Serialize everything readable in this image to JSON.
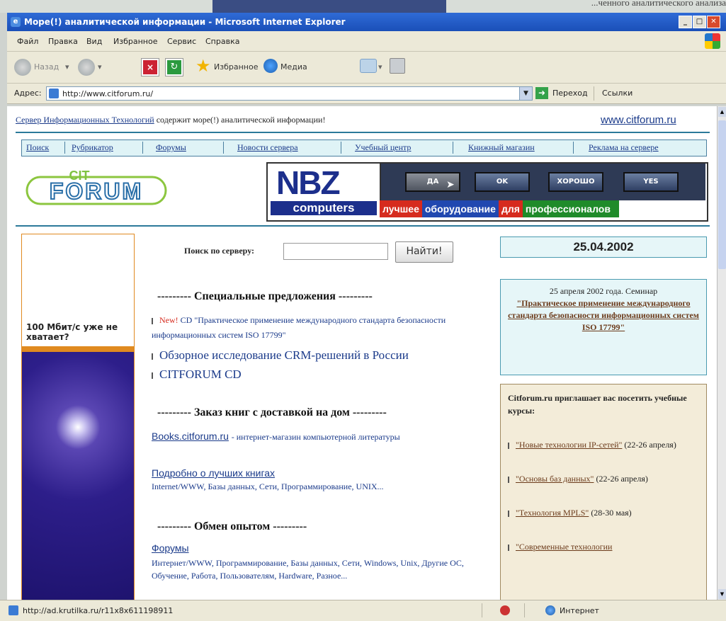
{
  "window": {
    "top_strip_text": "...ченного аналитического анализа",
    "title": "Море(!) аналитической информации - Microsoft Internet Explorer",
    "controls": {
      "minimize": "_",
      "maximize": "□",
      "close": "✕"
    }
  },
  "menu": [
    "Файл",
    "Правка",
    "Вид",
    "Избранное",
    "Сервис",
    "Справка"
  ],
  "toolbar": {
    "back": "Назад",
    "favorites": "Избранное",
    "media": "Медиа"
  },
  "address": {
    "label": "Адрес:",
    "url": "http://www.citforum.ru/",
    "go": "Переход",
    "links": "Ссылки"
  },
  "page": {
    "header_link": "Сервер Информационных Технологий",
    "header_rest": "содержит море(!) аналитической информации!",
    "site_url": "www.citforum.ru",
    "nav": [
      "Поиск",
      "Рубрикатор",
      "Форумы",
      "Новости сервера",
      "Учебный центр",
      "Книжный магазин",
      "Реклама на сервере"
    ],
    "banner": {
      "logo_top": "NBZ",
      "logo_bottom": "computers",
      "buttons": [
        "ДА",
        "OK",
        "ХОРОШО",
        "YES"
      ],
      "slogan": [
        "лучшее",
        "оборудование",
        "для",
        "профессионалов"
      ]
    },
    "left_ad": {
      "text": "100 Мбит/с уже не хватает?"
    },
    "search": {
      "label": "Поиск по серверу:",
      "value": "",
      "button": "Найти!"
    },
    "special": {
      "heading": "--------- Специальные предложения ---------",
      "new_badge": "New!",
      "item1": "CD \"Практическое применение международного стандарта безопасности информационных систем ISO 17799\"",
      "item2": "Обзорное исследование CRM-решений в России",
      "item3": "CITFORUM CD"
    },
    "books": {
      "heading": "--------- Заказ книг с доставкой на дом ---------",
      "site": "Books.citforum.ru",
      "site_desc": "- интернет-магазин компьютерной литературы",
      "best": "Подробно о лучших книгах",
      "best_desc": "Internet/WWW, Базы данных, Сети, Программирование, UNIX..."
    },
    "exchange": {
      "heading": "--------- Обмен опытом ---------",
      "forums": "Форумы",
      "forums_desc": "Интернет/WWW, Программирование, Базы данных, Сети, Windows, Unix, Другие ОС, Обучение, Работа, Пользователям, Hardware, Разное..."
    },
    "date": "25.04.2002",
    "seminar": {
      "text": "25 апреля 2002 года. Семинар",
      "link": "\"Практическое применение международного стандарта безопасности информационных систем ISO 17799\""
    },
    "courses": {
      "heading": "Citforum.ru приглашает вас посетить учебные курсы:",
      "items": [
        {
          "link": "\"Новые технологии IP-сетей\"",
          "dates": "(22-26 апреля)"
        },
        {
          "link": "\"Основы баз данных\"",
          "dates": "(22-26 апреля)"
        },
        {
          "link": "\"Технология MPLS\"",
          "dates": "(28-30 мая)"
        },
        {
          "link": "\"Современные технологии",
          "dates": ""
        }
      ]
    }
  },
  "status": {
    "url": "http://ad.krutilka.ru/r11x8x611198911",
    "zone": "Интернет"
  }
}
